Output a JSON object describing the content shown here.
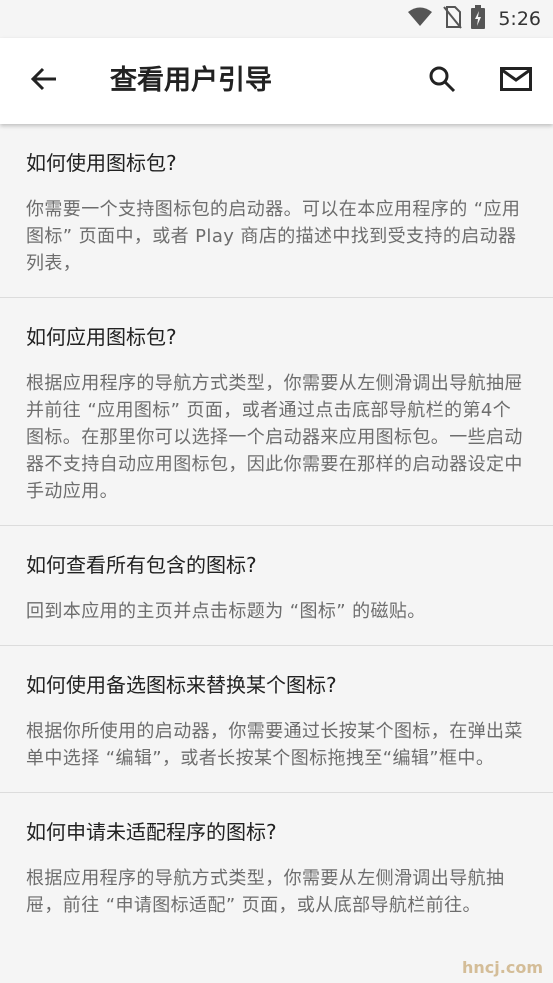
{
  "status": {
    "time": "5:26",
    "icons": [
      "wifi-icon",
      "no-sim-icon",
      "battery-charging-icon"
    ]
  },
  "toolbar": {
    "title": "查看用户引导",
    "back_icon": "arrow-back-icon",
    "search_icon": "search-icon",
    "mail_icon": "mail-icon"
  },
  "faq": [
    {
      "question": "如何使用图标包?",
      "answer": "你需要一个支持图标包的启动器。可以在本应用程序的 “应用图标” 页面中，或者 Play 商店的描述中找到受支持的启动器列表，"
    },
    {
      "question": "如何应用图标包?",
      "answer": "根据应用程序的导航方式类型，你需要从左侧滑调出导航抽屉并前往 “应用图标” 页面，或者通过点击底部导航栏的第4个图标。在那里你可以选择一个启动器来应用图标包。一些启动器不支持自动应用图标包，因此你需要在那样的启动器设定中手动应用。"
    },
    {
      "question": "如何查看所有包含的图标?",
      "answer": "回到本应用的主页并点击标题为 “图标” 的磁贴。"
    },
    {
      "question": "如何使用备选图标来替换某个图标?",
      "answer": "根据你所使用的启动器，你需要通过长按某个图标，在弹出菜单中选择 “编辑”，或者长按某个图标拖拽至“编辑”框中。"
    },
    {
      "question": "如何申请未适配程序的图标?",
      "answer": "根据应用程序的导航方式类型，你需要从左侧滑调出导航抽屉，前往 “申请图标适配” 页面，或从底部导航栏前往。"
    }
  ],
  "watermark": "hncj.com"
}
